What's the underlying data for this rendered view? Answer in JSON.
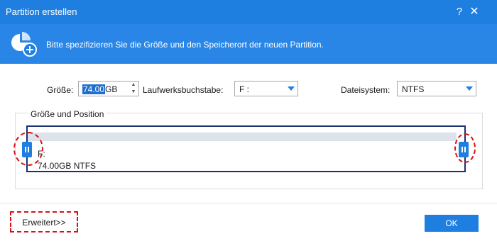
{
  "window": {
    "title": "Partition erstellen",
    "help_label": "?",
    "close_label": "✕"
  },
  "banner": {
    "text": "Bitte spezifizieren Sie die Größe und den Speicherort der neuen Partition."
  },
  "form": {
    "size_label": "Größe:",
    "size_value": "74.00",
    "size_unit": "GB",
    "drive_letter_label": "Laufwerksbuchstabe:",
    "drive_letter_value": "F :",
    "filesystem_label": "Dateisystem:",
    "filesystem_value": "NTFS"
  },
  "position": {
    "group_title": "Größe und Position",
    "partition_drive": "F:",
    "partition_info": "74.00GB NTFS"
  },
  "footer": {
    "advanced_label": "Erweitert>>",
    "ok_label": "OK"
  },
  "colors": {
    "accent": "#1f7fe0",
    "banner": "#2a86e6",
    "panel_border": "#1a2f6e",
    "highlight_dash": "#d9101b"
  }
}
